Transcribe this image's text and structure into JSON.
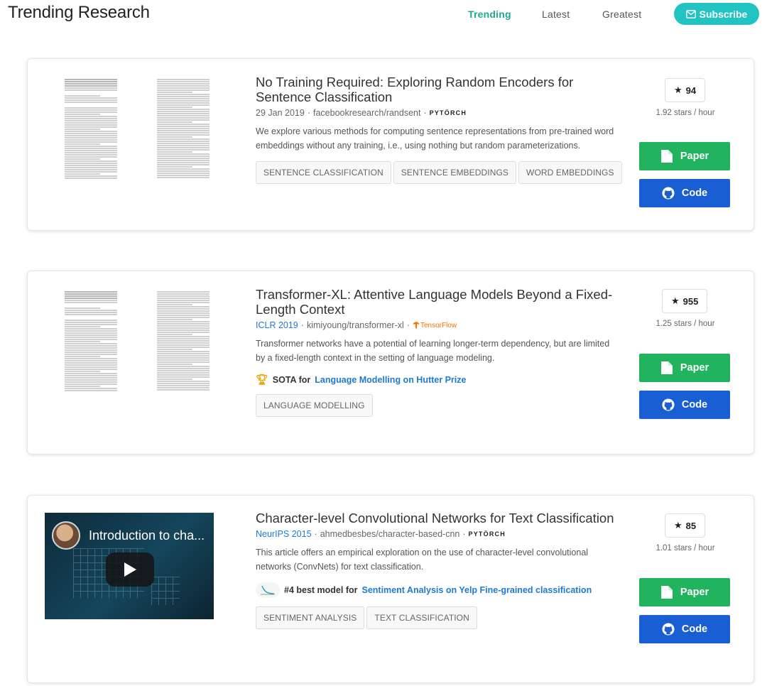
{
  "header": {
    "title": "Trending Research",
    "nav": [
      {
        "label": "Trending",
        "active": true
      },
      {
        "label": "Latest",
        "active": false
      },
      {
        "label": "Greatest",
        "active": false
      }
    ],
    "subscribe_label": "Subscribe",
    "subscribe_icon": "envelope-icon",
    "accent_color": "#21c3c3",
    "active_nav_color": "#1aaa8f"
  },
  "papers": [
    {
      "title": "No Training Required: Exploring Random Encoders for Sentence Classification",
      "date": "29 Jan 2019",
      "conference": "",
      "repo": "facebookresearch/randsent",
      "framework": "PyTorch",
      "framework_text": "PYTÖRCH",
      "abstract": "We explore various methods for computing sentence representations from pre-trained word embeddings without any training, i.e., using nothing but random parameterizations.",
      "tags": [
        "SENTENCE CLASSIFICATION",
        "SENTENCE EMBEDDINGS",
        "WORD EMBEDDINGS"
      ],
      "stars": "94",
      "rate": "1.92 stars / hour",
      "paper_label": "Paper",
      "code_label": "Code"
    },
    {
      "title": "Transformer-XL: Attentive Language Models Beyond a Fixed-Length Context",
      "date": "",
      "conference": "ICLR 2019",
      "repo": "kimiyoung/transformer-xl",
      "framework": "TensorFlow",
      "framework_text": "TensorFlow",
      "abstract": "Transformer networks have a potential of learning longer-term dependency, but are limited by a fixed-length context in the setting of language modeling.",
      "sota": {
        "prefix": "SOTA for",
        "task": "Language Modelling on Hutter Prize",
        "icon": "trophy-icon"
      },
      "tags": [
        "LANGUAGE MODELLING"
      ],
      "stars": "955",
      "rate": "1.25 stars / hour",
      "paper_label": "Paper",
      "code_label": "Code"
    },
    {
      "title": "Character-level Convolutional Networks for Text Classification",
      "date": "",
      "conference": "NeurIPS 2015",
      "repo": "ahmedbesbes/character-based-cnn",
      "framework": "PyTorch",
      "framework_text": "PYTÖRCH",
      "abstract": "This article offers an empirical exploration on the use of character-level convolutional networks (ConvNets) for text classification.",
      "sota": {
        "prefix": "#4 best model for",
        "task": "Sentiment Analysis on Yelp Fine-grained classification",
        "icon": "chart-icon"
      },
      "video_title": "Introduction to cha...",
      "tags": [
        "SENTIMENT ANALYSIS",
        "TEXT CLASSIFICATION"
      ],
      "stars": "85",
      "rate": "1.01 stars / hour",
      "paper_label": "Paper",
      "code_label": "Code"
    }
  ],
  "colors": {
    "paper_button": "#21b35d",
    "code_button": "#1a5ed4",
    "link": "#1f7ad1"
  }
}
